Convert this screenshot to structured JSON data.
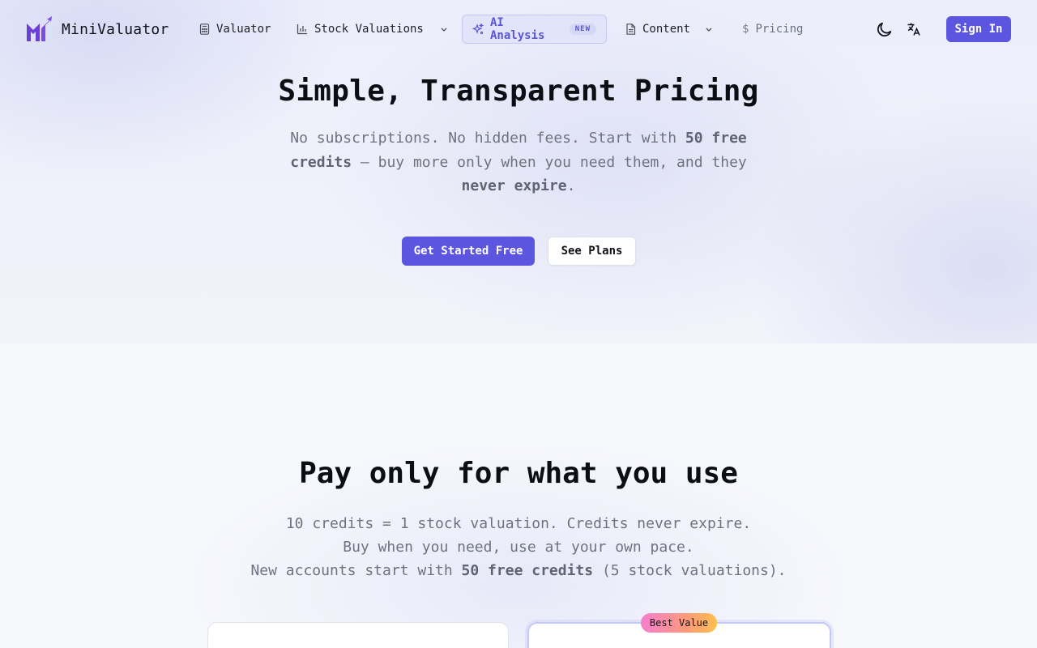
{
  "brand": {
    "name": "MiniValuator",
    "accent": "#5b55e0"
  },
  "nav": {
    "items": [
      {
        "label": "Valuator",
        "icon": "calculator-icon"
      },
      {
        "label": "Stock Valuations",
        "icon": "bar-chart-icon",
        "has_dropdown": true
      },
      {
        "label": "AI Analysis",
        "icon": "sparkles-icon",
        "badge": "NEW",
        "active": true
      },
      {
        "label": "Content",
        "icon": "document-icon",
        "has_dropdown": true
      },
      {
        "label": "Pricing",
        "icon": "dollar-icon"
      }
    ],
    "theme_toggle_icon": "moon-icon",
    "language_icon": "translate-icon",
    "sign_in_label": "Sign In"
  },
  "hero": {
    "title": "Simple, Transparent Pricing",
    "subtitle_parts": {
      "a": "No subscriptions. No hidden fees. Start with ",
      "b": "50 free credits",
      "c": " — buy more only when you need them, and they ",
      "d": "never expire",
      "e": "."
    },
    "primary_cta": "Get Started Free",
    "secondary_cta": "See Plans"
  },
  "pricing": {
    "title": "Pay only for what you use",
    "line1": "10 credits = 1 stock valuation. Credits never expire.",
    "line2": "Buy when you need, use at your own pace.",
    "line3_parts": {
      "a": "New accounts start with ",
      "b": "50 free credits",
      "c": " (5 stock valuations)."
    },
    "best_value_badge": "Best Value"
  }
}
